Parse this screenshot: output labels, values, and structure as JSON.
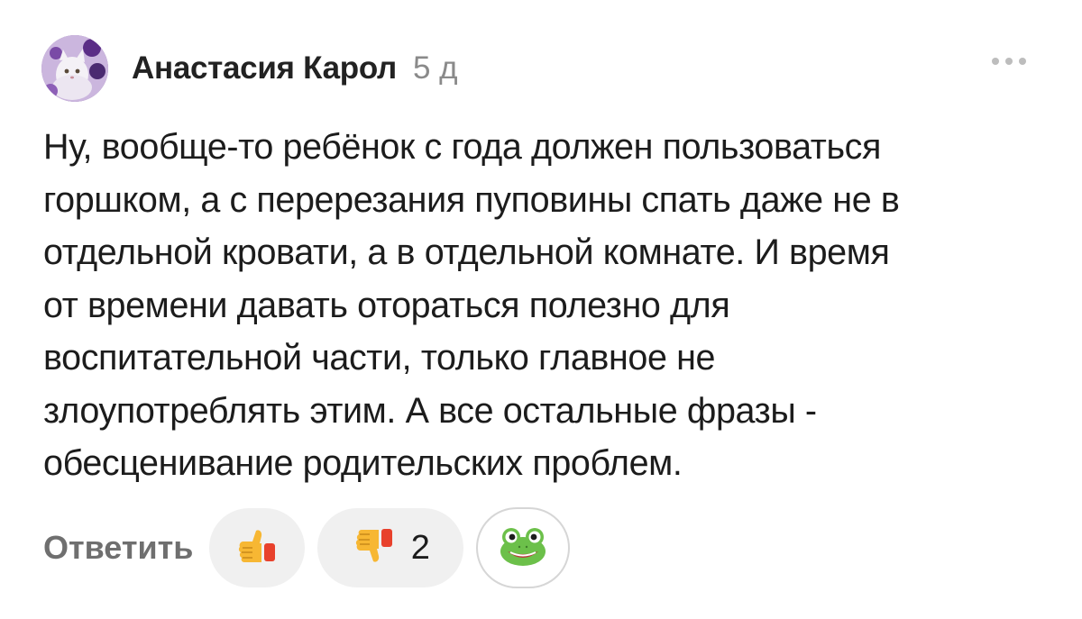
{
  "comment": {
    "author": "Анастасия Карол",
    "time": "5 д",
    "text": "Ну, вообще-то ребёнок с года должен пользоваться\nгоршком, а с перерезания пуповины спать даже не в\nотдельной кровати, а в отдельной комнате. И время\nот времени давать отораться полезно для\nвоспитательной части, только главное не\nзлоупотреблять этим. А все остальные фразы -\nобесценивание родительских проблем."
  },
  "actions": {
    "reply_label": "Ответить",
    "like_icon": "thumbs-up-icon",
    "dislike_icon": "thumbs-down-icon",
    "dislike_count": "2",
    "reaction_icon": "frog-face-icon"
  },
  "colors": {
    "author": "#222222",
    "time": "#8a8a8a",
    "reply": "#6f6f6f",
    "pill_bg": "#f0f0f0"
  }
}
